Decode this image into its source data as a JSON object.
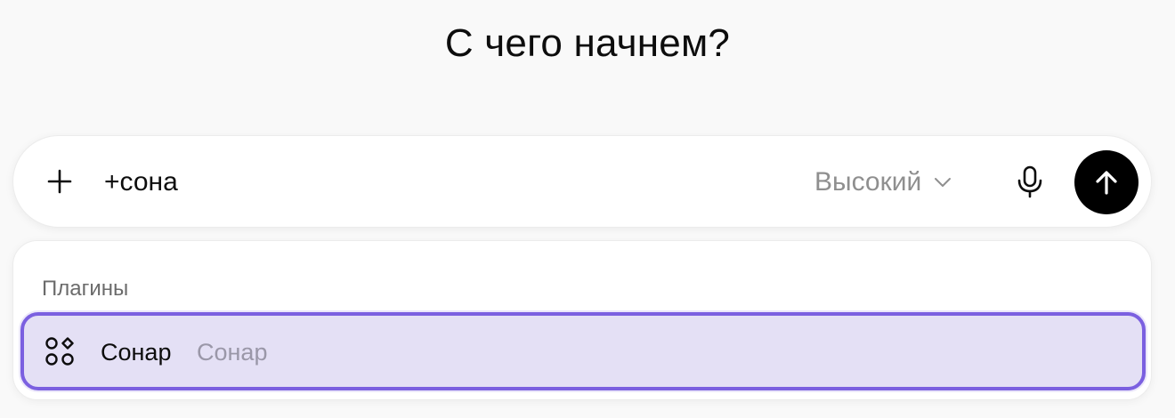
{
  "heading": "С чего начнем?",
  "composer": {
    "input_value": "+сона",
    "model_label": "Высокий",
    "icons": {
      "add": "plus-icon",
      "model_dropdown": "chevron-down-icon",
      "voice": "microphone-icon",
      "send": "arrow-up-icon"
    }
  },
  "dropdown": {
    "section_label": "Плагины",
    "options": [
      {
        "name": "Сонар",
        "description": "Сонар",
        "icon": "plugin-nodes-icon",
        "selected": true
      }
    ]
  },
  "colors": {
    "background": "#f9f9f9",
    "send_button": "#000000",
    "selection_border": "#7b60e0",
    "selection_fill": "#e4e0f5",
    "muted_text": "#8f8f8f"
  }
}
